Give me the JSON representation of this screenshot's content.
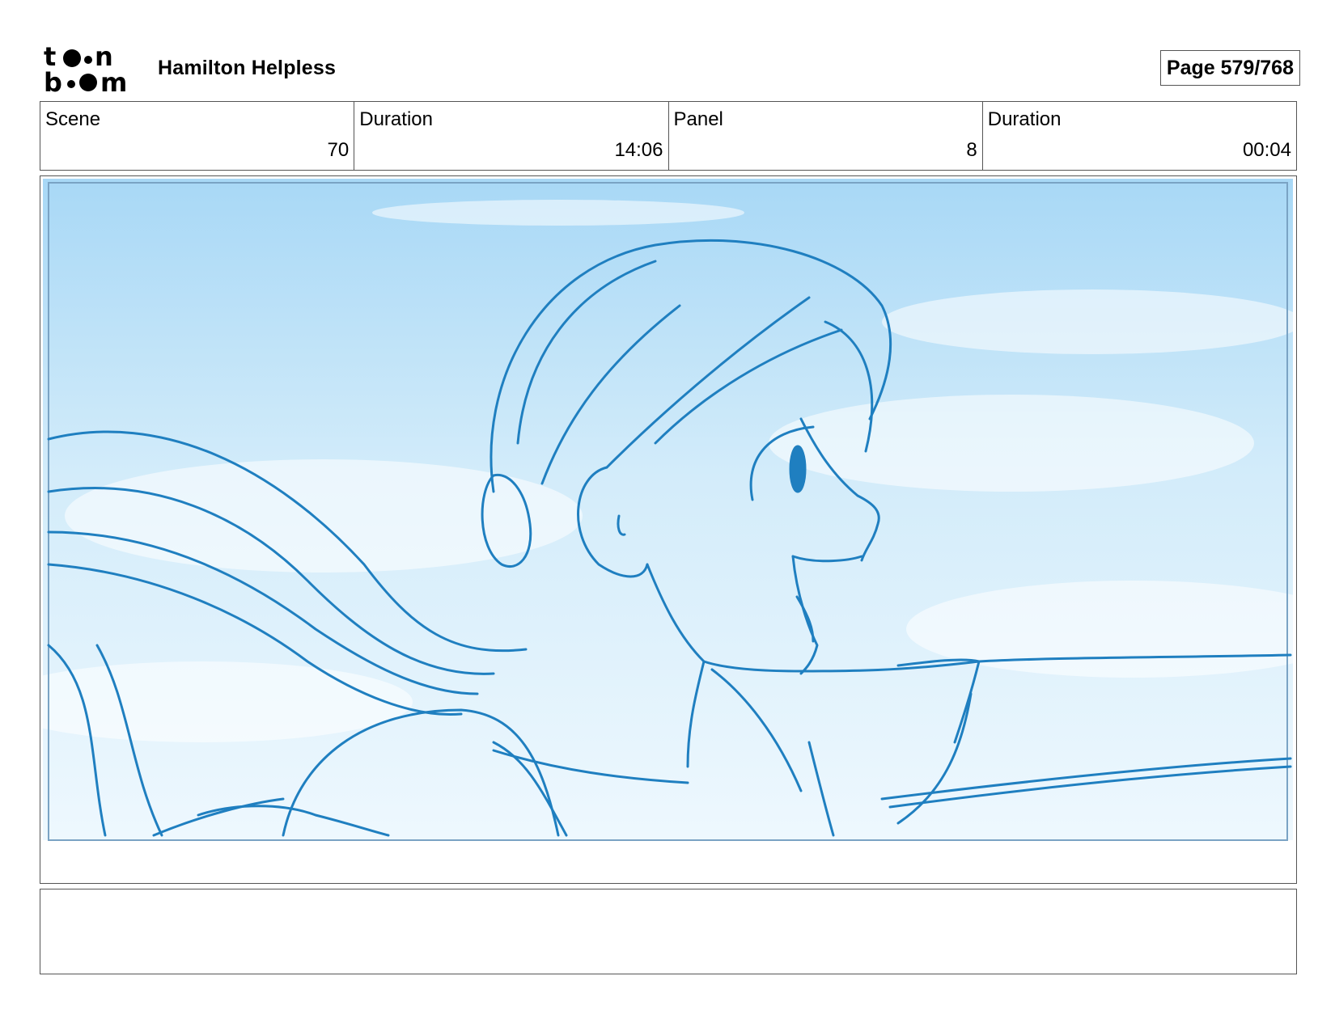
{
  "header": {
    "logo_name": "toon boom logo",
    "project_title": "Hamilton Helpless",
    "page_label": "Page 579/768"
  },
  "info": [
    {
      "label": "Scene",
      "value": "70"
    },
    {
      "label": "Duration",
      "value": "14:06"
    },
    {
      "label": "Panel",
      "value": "8"
    },
    {
      "label": "Duration",
      "value": "00:04"
    }
  ],
  "panel": {
    "sky_color": "#bfe3f7",
    "line_color": "#1f7fc0"
  },
  "notes": {
    "text": ""
  }
}
